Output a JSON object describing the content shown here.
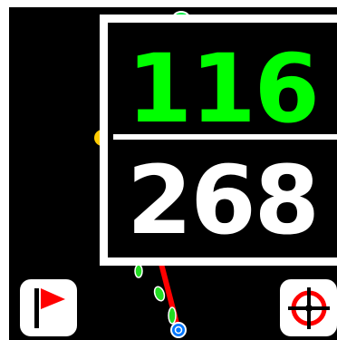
{
  "readout": {
    "top_value": "116",
    "bottom_value": "268",
    "top_color": "#00ff00",
    "bottom_color": "#ffffff"
  },
  "map": {
    "background_color": "#000000",
    "track_color": "#00ff44",
    "line_color": "#ff0000",
    "marker_color": "#ffcc00"
  },
  "buttons": {
    "flag_icon": "flag-icon",
    "target_icon": "crosshair-icon"
  }
}
